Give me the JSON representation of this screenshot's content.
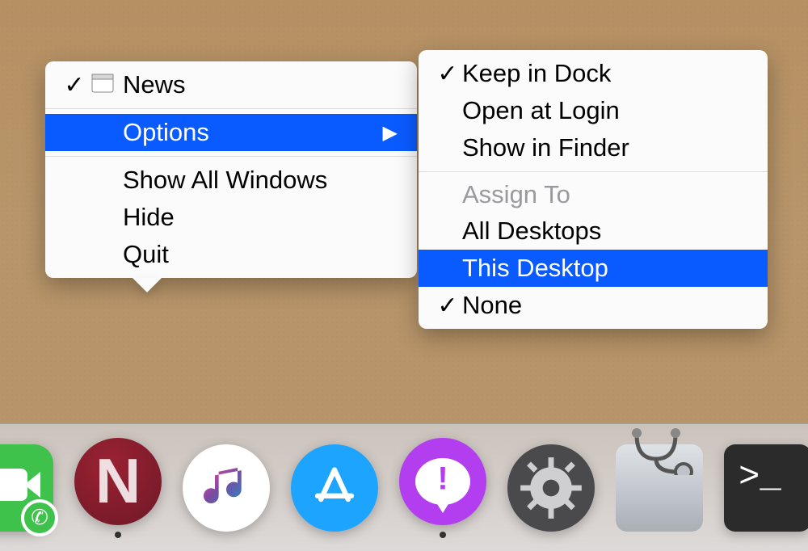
{
  "main_menu": {
    "window": {
      "label": "News",
      "checked": true
    },
    "options": {
      "label": "Options"
    },
    "show_all_windows": {
      "label": "Show All Windows"
    },
    "hide": {
      "label": "Hide"
    },
    "quit": {
      "label": "Quit"
    }
  },
  "submenu": {
    "keep_in_dock": {
      "label": "Keep in Dock",
      "checked": true
    },
    "open_at_login": {
      "label": "Open at Login",
      "checked": false
    },
    "show_in_finder": {
      "label": "Show in Finder"
    },
    "assign_to_header": "Assign To",
    "all_desktops": {
      "label": "All Desktops"
    },
    "this_desktop": {
      "label": "This Desktop"
    },
    "none": {
      "label": "None",
      "checked": true
    }
  },
  "dock": {
    "items": [
      {
        "name": "facetime",
        "running": false
      },
      {
        "name": "news",
        "running": true
      },
      {
        "name": "itunes",
        "running": false
      },
      {
        "name": "appstore",
        "running": false
      },
      {
        "name": "feedback",
        "running": true
      },
      {
        "name": "system-preferences",
        "running": false
      },
      {
        "name": "disk-utility",
        "running": false
      },
      {
        "name": "terminal",
        "running": false
      }
    ]
  }
}
